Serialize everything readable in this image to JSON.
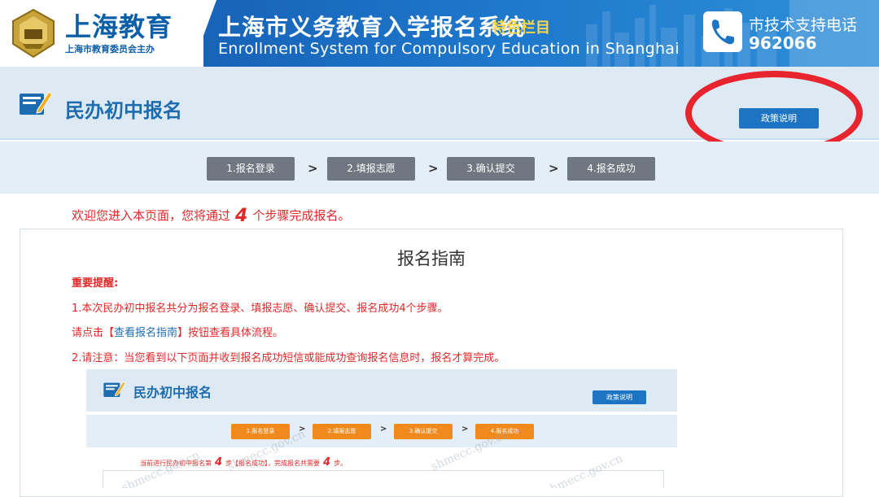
{
  "banner": {
    "logo_title": "上海教育",
    "logo_sub": "上海市教育委员会主办",
    "system_title": "上海市义务教育入学报名系统",
    "special_tag": "特色栏目",
    "system_title_en": "Enrollment System for Compulsory Education in Shanghai",
    "phone_label": "市技术支持电话",
    "phone_number": "962066"
  },
  "header": {
    "page_title": "民办初中报名",
    "policy_button": "政策说明"
  },
  "steps": [
    "1.报名登录",
    "2.填报志愿",
    "3.确认提交",
    "4.报名成功"
  ],
  "step_separator": ">",
  "welcome": {
    "prefix": "欢迎您进入本页面，您将通过",
    "count": "4",
    "suffix": "个步骤完成报名。"
  },
  "guide": {
    "title": "报名指南",
    "notice_heading": "重要提醒:",
    "line1": "1.本次民办初中报名共分为报名登录、填报志愿、确认提交、报名成功4个步骤。",
    "line2_prefix": "请点击【",
    "line2_link": "查看报名指南",
    "line2_suffix": "】按钮查看具体流程。",
    "line3": "2.请注意：当您看到以下页面并收到报名成功短信或能成功查询报名信息时，报名才算完成。"
  },
  "sample": {
    "page_title": "民办初中报名",
    "policy_button": "政策说明",
    "steps": [
      "1.报名登录",
      "2.填报志愿",
      "3.确认提交",
      "4.报名成功"
    ],
    "status_prefix": "当前进行民办初中报名第",
    "status_step": "4",
    "status_middle": "步【报名成功】，完成报名共需要",
    "status_total": "4",
    "status_suffix": "步。",
    "watermark": "shmecc.gov.cn"
  },
  "colors": {
    "brand_blue": "#1e6cb0",
    "button_blue": "#1d74c2",
    "step_gray": "#707780",
    "step_orange": "#f08a1d",
    "alert_red": "#e02a2a",
    "annotation_red": "#e8242e",
    "tag_yellow": "#ffd84a"
  },
  "icons": {
    "logo": "shanghai-education-emblem-icon",
    "phone": "phone-icon",
    "title": "edit-form-icon"
  }
}
